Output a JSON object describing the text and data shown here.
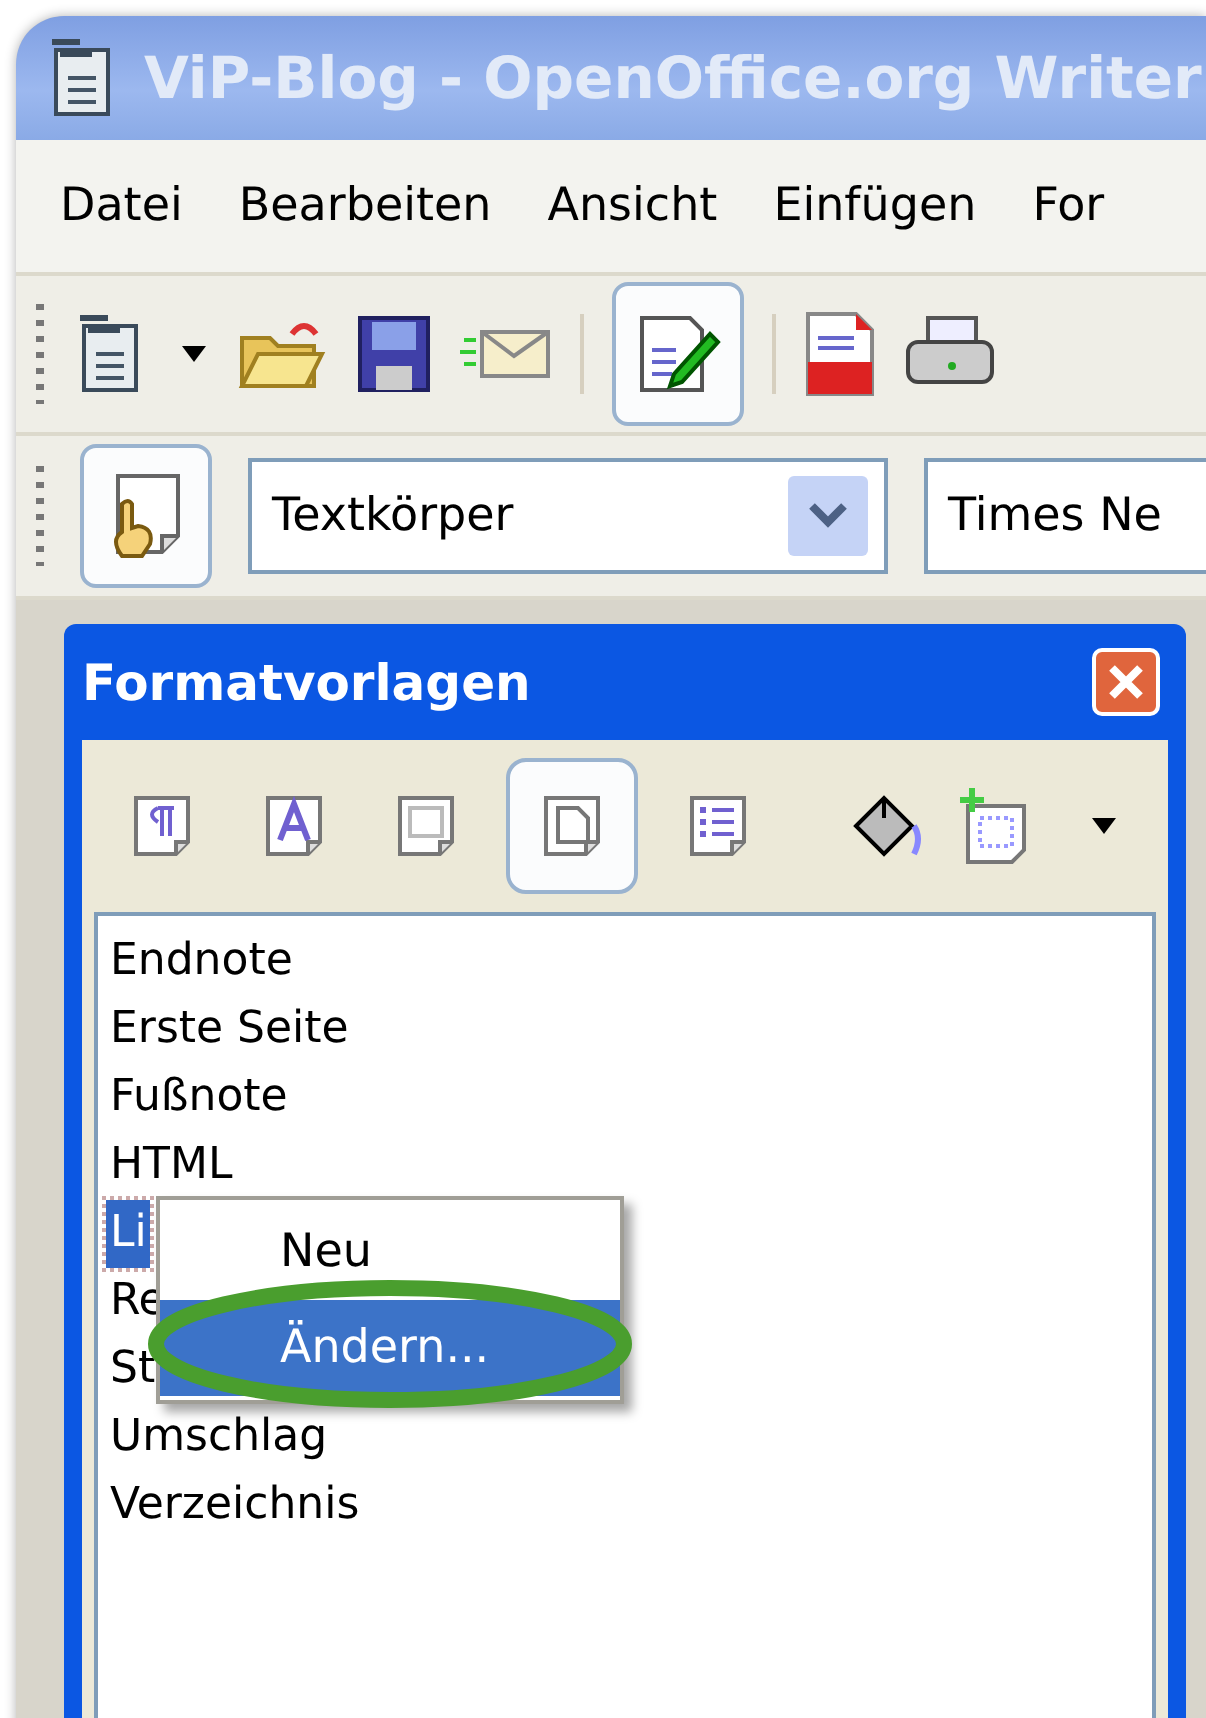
{
  "window": {
    "title": "ViP-Blog - OpenOffice.org Writer"
  },
  "menu_bar": [
    "Datei",
    "Bearbeiten",
    "Ansicht",
    "Einfügen",
    "For"
  ],
  "standard_toolbar": [
    {
      "kind": "new"
    },
    {
      "kind": "caret"
    },
    {
      "kind": "open"
    },
    {
      "kind": "save"
    },
    {
      "kind": "mail"
    },
    {
      "kind": "separator"
    },
    {
      "kind": "edit",
      "on": true
    },
    {
      "kind": "separator"
    },
    {
      "kind": "pdf"
    },
    {
      "kind": "print"
    }
  ],
  "formatting_toolbar": {
    "styles_button_on": true,
    "paragraph_style": "Textkörper",
    "font_name": "Times Ne"
  },
  "stylist": {
    "title": "Formatvorlagen",
    "categories": [
      {
        "kind": "paragraph",
        "selected": false
      },
      {
        "kind": "character",
        "selected": false
      },
      {
        "kind": "frame",
        "selected": false
      },
      {
        "kind": "page",
        "selected": true
      },
      {
        "kind": "list",
        "selected": false
      }
    ],
    "styles": [
      {
        "label": "Endnote",
        "selected": false
      },
      {
        "label": "Erste Seite",
        "selected": false
      },
      {
        "label": "Fußnote",
        "selected": false
      },
      {
        "label": "HTML",
        "selected": false
      },
      {
        "label": "Li",
        "selected": true
      },
      {
        "label": "Re",
        "selected": false
      },
      {
        "label": "St",
        "selected": false
      },
      {
        "label": "Umschlag",
        "selected": false
      },
      {
        "label": "Verzeichnis",
        "selected": false
      }
    ],
    "context_menu": [
      {
        "label": "Neu",
        "selected": false
      },
      {
        "label": "Ändern...",
        "selected": true
      }
    ]
  }
}
